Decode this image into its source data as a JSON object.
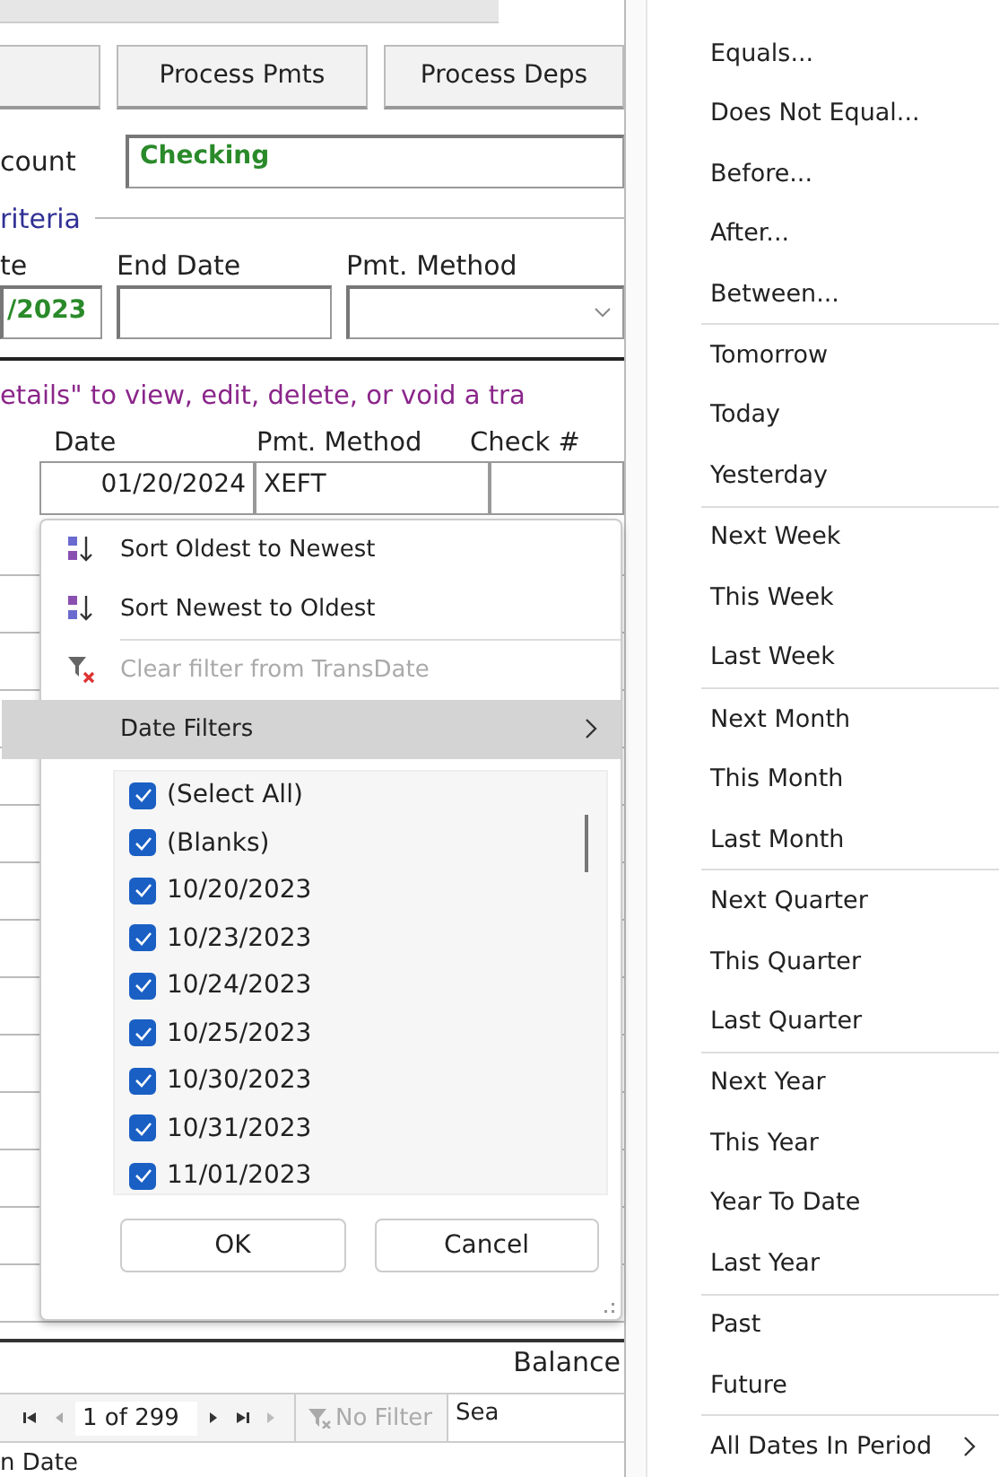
{
  "toolbar": {
    "buttons": [
      "Process Pmts",
      "Process Deps"
    ]
  },
  "account": {
    "label": "count",
    "value": "Checking"
  },
  "criteria": {
    "title": "riteria",
    "fields": [
      {
        "label": "te",
        "value": "/2023",
        "kind": "text"
      },
      {
        "label": "End Date",
        "kind": "text"
      },
      {
        "label": "Pmt. Method",
        "kind": "combo"
      }
    ]
  },
  "instruction": "etails\" to view, edit, delete, or void a tra",
  "table": {
    "columns": [
      "Date",
      "Pmt. Method",
      "Check #"
    ],
    "rows": [
      {
        "cells": [
          "01/20/2024",
          "XEFT"
        ]
      }
    ]
  },
  "filter_menu": {
    "items": [
      {
        "kind": "sort_asc",
        "label": "Sort Oldest to Newest",
        "disabled": false,
        "selected": false
      },
      {
        "kind": "sort_desc",
        "label": "Sort Newest to Oldest",
        "disabled": false,
        "selected": false
      },
      {
        "kind": "clear",
        "label": "Clear filter from TransDate",
        "disabled": true,
        "selected": false
      },
      {
        "kind": "submenu",
        "label": "Date Filters",
        "disabled": false,
        "selected": true
      }
    ],
    "checklist": [
      {
        "label": "(Select All)",
        "checked": true
      },
      {
        "label": "(Blanks)",
        "checked": true
      },
      {
        "label": "10/20/2023",
        "checked": true
      },
      {
        "label": "10/23/2023",
        "checked": true
      },
      {
        "label": "10/24/2023",
        "checked": true
      },
      {
        "label": "10/25/2023",
        "checked": true
      },
      {
        "label": "10/30/2023",
        "checked": true
      },
      {
        "label": "10/31/2023",
        "checked": true
      },
      {
        "label": "11/01/2023",
        "checked": true
      }
    ],
    "buttons": [
      "OK",
      "Cancel"
    ]
  },
  "date_filters": {
    "groups": [
      [
        {
          "label": "Equals..."
        },
        {
          "label": "Does Not Equal..."
        },
        {
          "label": "Before..."
        },
        {
          "label": "After..."
        },
        {
          "label": "Between..."
        }
      ],
      [
        {
          "label": "Tomorrow"
        },
        {
          "label": "Today"
        },
        {
          "label": "Yesterday"
        }
      ],
      [
        {
          "label": "Next Week"
        },
        {
          "label": "This Week"
        },
        {
          "label": "Last Week"
        }
      ],
      [
        {
          "label": "Next Month"
        },
        {
          "label": "This Month"
        },
        {
          "label": "Last Month"
        }
      ],
      [
        {
          "label": "Next Quarter"
        },
        {
          "label": "This Quarter"
        },
        {
          "label": "Last Quarter"
        }
      ],
      [
        {
          "label": "Next Year"
        },
        {
          "label": "This Year"
        },
        {
          "label": "Year To Date"
        },
        {
          "label": "Last Year"
        }
      ],
      [
        {
          "label": "Past"
        },
        {
          "label": "Future"
        }
      ],
      [
        {
          "label": "All Dates In Period",
          "kind": "submenu"
        }
      ]
    ]
  },
  "footer": {
    "balance_label": "Balance",
    "record": "1 of 299",
    "filter": "No Filter",
    "search": "Sea",
    "caption": "n Date"
  }
}
